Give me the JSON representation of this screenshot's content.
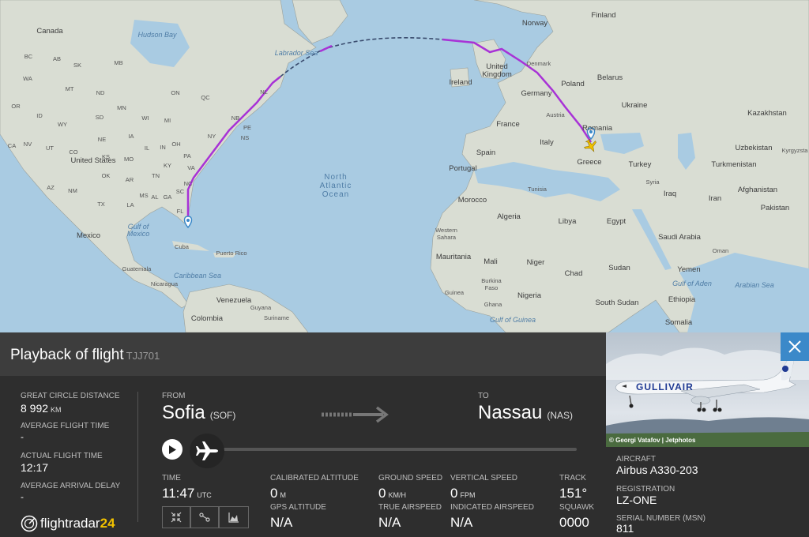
{
  "map": {
    "countries": [
      "Canada",
      "United States",
      "Mexico",
      "Cuba",
      "Guatemala",
      "Nicaragua",
      "Puerto Rico",
      "Venezuela",
      "Colombia",
      "Guyana",
      "Suriname",
      "Norway",
      "Finland",
      "United Kingdom",
      "Ireland",
      "Denmark",
      "Poland",
      "Belarus",
      "Ukraine",
      "Germany",
      "France",
      "Austria",
      "Italy",
      "Romania",
      "Greece",
      "Turkey",
      "Spain",
      "Portugal",
      "Morocco",
      "Algeria",
      "Tunisia",
      "Libya",
      "Egypt",
      "Western Sahara",
      "Mauritania",
      "Mali",
      "Niger",
      "Chad",
      "Sudan",
      "Burkina Faso",
      "Guinea",
      "Ghana",
      "Nigeria",
      "South Sudan",
      "Ethiopia",
      "Somalia",
      "Syria",
      "Iraq",
      "Iran",
      "Saudi Arabia",
      "Oman",
      "Yemen",
      "Kazakhstan",
      "Uzbekistan",
      "Turkmenistan",
      "Kyrgyzsta",
      "Afghanistan",
      "Pakistan"
    ],
    "water": [
      "Hudson Bay",
      "Labrador Sea",
      "Gulf of Mexico",
      "Caribbean Sea",
      "Gulf of Guinea",
      "Gulf of Aden",
      "Arabian Sea"
    ],
    "ocean": "North Atlantic Ocean",
    "states": [
      "WA",
      "MT",
      "ND",
      "MN",
      "OR",
      "ID",
      "WY",
      "SD",
      "NE",
      "IA",
      "WI",
      "MI",
      "NV",
      "UT",
      "CO",
      "KS",
      "MO",
      "IL",
      "IN",
      "OH",
      "PA",
      "NY",
      "CA",
      "AZ",
      "NM",
      "OK",
      "AR",
      "TN",
      "KY",
      "VA",
      "NC",
      "SC",
      "GA",
      "AL",
      "MS",
      "LA",
      "TX",
      "FL",
      "ON",
      "QC",
      "NB",
      "NS",
      "PE",
      "NL",
      "SK",
      "MB",
      "AB",
      "BC"
    ]
  },
  "panel": {
    "title": "Playback of flight",
    "flight_number": "TJJ701",
    "stats": [
      {
        "label": "GREAT CIRCLE DISTANCE",
        "value": "8 992",
        "unit": "KM"
      },
      {
        "label": "AVERAGE FLIGHT TIME",
        "value": "-",
        "unit": ""
      },
      {
        "label": "ACTUAL FLIGHT TIME",
        "value": "12:17",
        "unit": ""
      },
      {
        "label": "AVERAGE ARRIVAL DELAY",
        "value": "-",
        "unit": ""
      }
    ],
    "from_label": "FROM",
    "from_city": "Sofia",
    "from_code": "(SOF)",
    "to_label": "TO",
    "to_city": "Nassau",
    "to_code": "(NAS)",
    "playback_progress": 0.0,
    "time_label": "TIME",
    "time_value": "11:47",
    "time_unit": "UTC",
    "telemetry": {
      "cal_alt_label": "CALIBRATED ALTITUDE",
      "cal_alt_value": "0",
      "cal_alt_unit": "M",
      "gps_alt_label": "GPS ALTITUDE",
      "gps_alt_value": "N/A",
      "ground_speed_label": "GROUND SPEED",
      "ground_speed_value": "0",
      "ground_speed_unit": "KM/H",
      "true_airspeed_label": "TRUE AIRSPEED",
      "true_airspeed_value": "N/A",
      "vertical_speed_label": "VERTICAL SPEED",
      "vertical_speed_value": "0",
      "vertical_speed_unit": "FPM",
      "indicated_airspeed_label": "INDICATED AIRSPEED",
      "indicated_airspeed_value": "N/A",
      "track_label": "TRACK",
      "track_value": "151°",
      "squawk_label": "SQUAWK",
      "squawk_value": "0000"
    },
    "logo_text": "flightradar",
    "logo_num": "24"
  },
  "aircraft": {
    "photo_credit": "© Georgi Vatafov | Jetphotos",
    "livery_text": "GULLIVAIR",
    "aircraft_label": "AIRCRAFT",
    "aircraft_value": "Airbus A330-203",
    "registration_label": "REGISTRATION",
    "registration_value": "LZ-ONE",
    "serial_label": "SERIAL NUMBER (MSN)",
    "serial_value": "811"
  },
  "colors": {
    "route": "#a832d6",
    "route_dashed": "#3a4c6e",
    "accent": "#3b89c9",
    "panel": "#2e2e2e",
    "header": "#3d3d3d"
  }
}
